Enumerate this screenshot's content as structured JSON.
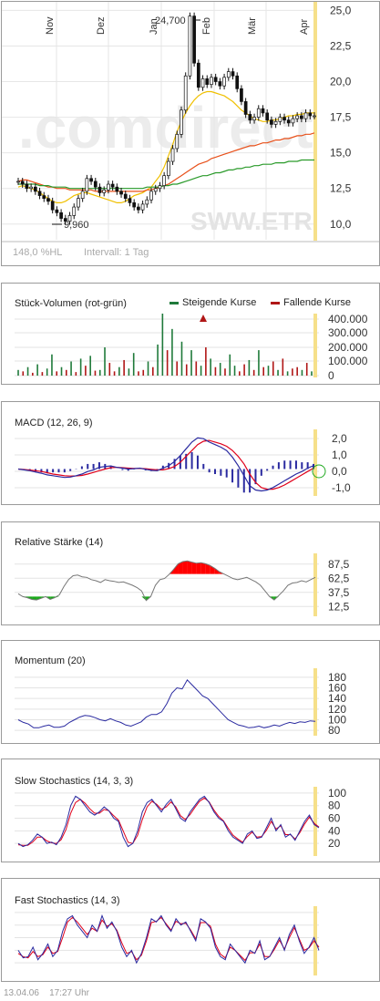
{
  "price": {
    "months": [
      "Nov",
      "Dez",
      "Jan",
      "Feb",
      "Mär",
      "Apr"
    ],
    "y_ticks": [
      "25,0",
      "22,5",
      "20,0",
      "17,5",
      "15,0",
      "12,5",
      "10,0"
    ],
    "high_label": "24,700",
    "low_label": "9,960",
    "watermark": ".comdirect",
    "ticker": "SWW.ETR",
    "info_range": "148,0 %HL",
    "info_interval": "Intervall: 1 Tag"
  },
  "volume": {
    "title": "Stück-Volumen (rot-grün)",
    "legend_up": "Steigende Kurse",
    "legend_down": "Fallende Kurse",
    "y_ticks": [
      "400.000",
      "300.000",
      "200.000",
      "100.000",
      "0"
    ]
  },
  "macd": {
    "title": "MACD (12, 26, 9)",
    "y_ticks": [
      "2,0",
      "1,0",
      "0,0",
      "-1,0"
    ]
  },
  "rsi": {
    "title": "Relative Stärke (14)",
    "y_ticks": [
      "87,5",
      "62,5",
      "37,5",
      "12,5"
    ]
  },
  "momentum": {
    "title": "Momentum (20)",
    "y_ticks": [
      "180",
      "160",
      "140",
      "120",
      "100",
      "80"
    ]
  },
  "slow_stoch": {
    "title": "Slow Stochastics (14, 3, 3)",
    "y_ticks": [
      "100",
      "80",
      "60",
      "40",
      "20"
    ]
  },
  "fast_stoch": {
    "title": "Fast Stochastics (14, 3)"
  },
  "footer": {
    "date": "13.04.06",
    "time": "17:27 Uhr"
  },
  "colors": {
    "up": "#1f7a3a",
    "down": "#b01616",
    "ma_short": "#f0c000",
    "ma_mid": "#e8501a",
    "ma_long": "#2a9a2a",
    "indicator": "#2a2aa0",
    "signal": "#e0001a",
    "highlight": "#f6e08a"
  },
  "chart_data": [
    {
      "type": "line",
      "title": "",
      "x": [
        0,
        5,
        10,
        15,
        20,
        25,
        30,
        35,
        40,
        45,
        50,
        55,
        60,
        65,
        70,
        75,
        78,
        80,
        85,
        90,
        95,
        100,
        105,
        110,
        115,
        120,
        125,
        130,
        135,
        140,
        145,
        150,
        155,
        160,
        165,
        170,
        175,
        180,
        185,
        190,
        195,
        200,
        205,
        210,
        215,
        220,
        225,
        230,
        235,
        240,
        245,
        250,
        255,
        260,
        265,
        270,
        275,
        280,
        285,
        290,
        295,
        300,
        305,
        310,
        315,
        320,
        325,
        330,
        335,
        340
      ],
      "xlabel": "",
      "ylabel": "",
      "x_axis_labels": [
        "Nov",
        "Dez",
        "Jan",
        "Feb",
        "Mär",
        "Apr"
      ],
      "ylim": [
        8.9,
        25.6
      ],
      "series": [
        {
          "values": [
            13.0,
            12.8,
            12.5,
            12.6,
            12.3,
            12.0,
            11.8,
            11.6,
            11.0,
            10.8,
            10.4,
            10.2,
            10.6,
            11.2,
            11.8,
            12.3,
            13.2,
            13.0,
            12.6,
            12.2,
            12.4,
            12.8,
            12.6,
            12.3,
            12.1,
            11.8,
            11.5,
            11.2,
            11.0,
            11.4,
            11.7,
            12.3,
            12.5,
            12.7,
            13.4,
            14.4,
            15.3,
            16.3,
            18.0,
            20.4,
            24.6,
            21.3,
            19.6,
            20.2,
            19.8,
            20.3,
            20.0,
            19.7,
            20.3,
            20.7,
            20.4,
            19.5,
            18.6,
            17.7,
            17.3,
            17.5,
            18.1,
            17.8,
            17.3,
            17.0,
            17.2,
            17.5,
            17.3,
            17.1,
            17.4,
            17.6,
            17.4,
            17.8,
            17.6,
            17.6
          ]
        },
        {
          "values": [
            12.6,
            12.7,
            12.6,
            12.5,
            12.4,
            12.2,
            12.0,
            11.8,
            11.6,
            11.5,
            11.5,
            11.6,
            11.8,
            12.0,
            12.1,
            12.2,
            12.2,
            12.1,
            12.0,
            11.9,
            11.8,
            11.7,
            11.6,
            11.5,
            11.5,
            11.6,
            11.8,
            12.0,
            12.1,
            12.2,
            12.4,
            12.6,
            13.0,
            13.4,
            14.0,
            14.8,
            15.6,
            16.5,
            17.2,
            17.8,
            18.3,
            18.7,
            19.0,
            19.2,
            19.3,
            19.3,
            19.2,
            19.1,
            19.0,
            18.8,
            18.6,
            18.3,
            18.0,
            17.8,
            17.6,
            17.4,
            17.3,
            17.2,
            17.2,
            17.3,
            17.3,
            17.4,
            17.5,
            17.6,
            17.6,
            17.7,
            17.7,
            17.8,
            17.8,
            17.8
          ]
        },
        {
          "values": [
            13.0,
            13.1,
            13.1,
            13.0,
            12.9,
            12.8,
            12.7,
            12.6,
            12.6,
            12.5,
            12.5,
            12.5,
            12.4,
            12.4,
            12.4,
            12.4,
            12.4,
            12.4,
            12.3,
            12.3,
            12.3,
            12.3,
            12.3,
            12.3,
            12.3,
            12.3,
            12.3,
            12.3,
            12.3,
            12.3,
            12.4,
            12.4,
            12.5,
            12.6,
            12.7,
            12.8,
            13.0,
            13.2,
            13.4,
            13.6,
            13.8,
            14.0,
            14.2,
            14.3,
            14.4,
            14.6,
            14.7,
            14.8,
            14.9,
            15.0,
            15.1,
            15.2,
            15.3,
            15.4,
            15.5,
            15.5,
            15.6,
            15.7,
            15.7,
            15.8,
            15.9,
            15.9,
            16.0,
            16.0,
            16.1,
            16.2,
            16.2,
            16.3,
            16.3,
            16.4
          ]
        },
        {
          "values": [
            12.8,
            12.8,
            12.8,
            12.8,
            12.8,
            12.7,
            12.7,
            12.7,
            12.6,
            12.6,
            12.6,
            12.6,
            12.5,
            12.5,
            12.5,
            12.5,
            12.5,
            12.5,
            12.5,
            12.5,
            12.5,
            12.5,
            12.5,
            12.5,
            12.5,
            12.5,
            12.5,
            12.5,
            12.5,
            12.5,
            12.6,
            12.6,
            12.6,
            12.6,
            12.7,
            12.7,
            12.8,
            12.8,
            12.9,
            13.0,
            13.1,
            13.2,
            13.3,
            13.4,
            13.4,
            13.5,
            13.6,
            13.6,
            13.7,
            13.8,
            13.8,
            13.9,
            13.9,
            14.0,
            14.0,
            14.1,
            14.1,
            14.2,
            14.2,
            14.2,
            14.3,
            14.3,
            14.3,
            14.4,
            14.4,
            14.4,
            14.5,
            14.5,
            14.5,
            14.5
          ]
        }
      ]
    },
    {
      "type": "bar",
      "title": "",
      "ylim": [
        0,
        400000
      ],
      "values": [
        40000,
        30000,
        60000,
        20000,
        80000,
        25000,
        50000,
        150000,
        30000,
        60000,
        40000,
        100000,
        25000,
        120000,
        70000,
        140000,
        35000,
        40000,
        200000,
        90000,
        30000,
        60000,
        110000,
        50000,
        160000,
        30000,
        40000,
        100000,
        60000,
        220000,
        450000,
        180000,
        330000,
        100000,
        240000,
        80000,
        180000,
        100000,
        70000,
        200000,
        120000,
        60000,
        90000,
        50000,
        150000,
        70000,
        30000,
        80000,
        110000,
        40000,
        180000,
        60000,
        70000,
        100000,
        40000,
        120000,
        30000,
        50000,
        60000,
        40000,
        90000,
        30000
      ],
      "directions": [
        "u",
        "d",
        "u",
        "d",
        "u",
        "d",
        "u",
        "u",
        "d",
        "u",
        "d",
        "u",
        "d",
        "u",
        "d",
        "u",
        "d",
        "u",
        "u",
        "d",
        "d",
        "u",
        "d",
        "u",
        "u",
        "d",
        "d",
        "u",
        "d",
        "u",
        "u",
        "d",
        "u",
        "d",
        "u",
        "d",
        "u",
        "d",
        "u",
        "d",
        "u",
        "d",
        "u",
        "d",
        "u",
        "u",
        "d",
        "d",
        "u",
        "d",
        "u",
        "d",
        "u",
        "d",
        "u",
        "d",
        "u",
        "d",
        "d",
        "u",
        "d",
        "u"
      ]
    },
    {
      "type": "line",
      "title": "",
      "ylim": [
        -1.6,
        2.3
      ],
      "series": [
        {
          "values": [
            0,
            -0.05,
            -0.1,
            -0.18,
            -0.25,
            -0.35,
            -0.4,
            -0.45,
            -0.5,
            -0.48,
            -0.4,
            -0.3,
            -0.15,
            -0.05,
            0.1,
            0.15,
            0.18,
            0.1,
            0.05,
            0,
            0.02,
            0.05,
            -0.02,
            -0.08,
            -0.1,
            0.05,
            0.2,
            0.45,
            0.8,
            1.2,
            1.6,
            1.85,
            1.8,
            1.6,
            1.45,
            1.3,
            1.1,
            0.7,
            0.2,
            -0.4,
            -1.0,
            -1.25,
            -1.3,
            -1.25,
            -1.1,
            -0.9,
            -0.7,
            -0.5,
            -0.3,
            -0.15,
            0.05,
            0.2
          ]
        },
        {
          "values": [
            0,
            -0.03,
            -0.06,
            -0.1,
            -0.15,
            -0.22,
            -0.3,
            -0.35,
            -0.4,
            -0.42,
            -0.41,
            -0.38,
            -0.3,
            -0.2,
            -0.1,
            0,
            0.08,
            0.1,
            0.08,
            0.05,
            0.03,
            0.03,
            0.02,
            -0.02,
            -0.05,
            -0.05,
            0.02,
            0.15,
            0.4,
            0.75,
            1.1,
            1.45,
            1.65,
            1.7,
            1.6,
            1.5,
            1.35,
            1.1,
            0.75,
            0.3,
            -0.3,
            -0.8,
            -1.1,
            -1.2,
            -1.2,
            -1.1,
            -0.95,
            -0.75,
            -0.55,
            -0.35,
            -0.15,
            0.05
          ]
        }
      ]
    },
    {
      "type": "line",
      "title": "",
      "ylim": [
        0,
        100
      ],
      "values": [
        35,
        30,
        28,
        25,
        24,
        27,
        30,
        25,
        28,
        33,
        48,
        60,
        67,
        68,
        65,
        64,
        60,
        58,
        55,
        60,
        58,
        57,
        55,
        56,
        53,
        50,
        46,
        40,
        23,
        30,
        50,
        60,
        62,
        69,
        78,
        88,
        92,
        93,
        91,
        89,
        90,
        88,
        85,
        80,
        74,
        70,
        66,
        62,
        60,
        62,
        64,
        60,
        56,
        50,
        40,
        30,
        24,
        32,
        40,
        50,
        54,
        55,
        58,
        56,
        60,
        64
      ]
    },
    {
      "type": "line",
      "title": "",
      "ylim": [
        70,
        190
      ],
      "values": [
        100,
        95,
        92,
        85,
        85,
        88,
        90,
        86,
        86,
        88,
        95,
        100,
        105,
        108,
        107,
        104,
        100,
        98,
        102,
        98,
        95,
        90,
        88,
        92,
        96,
        105,
        110,
        110,
        115,
        130,
        150,
        160,
        158,
        175,
        165,
        155,
        145,
        140,
        130,
        120,
        110,
        100,
        95,
        90,
        88,
        85,
        86,
        88,
        85,
        87,
        90,
        88,
        92,
        95,
        93,
        96,
        95,
        98,
        97
      ]
    },
    {
      "type": "line",
      "title": "",
      "ylim": [
        0,
        110
      ],
      "series": [
        {
          "values": [
            20,
            15,
            18,
            25,
            35,
            30,
            20,
            22,
            18,
            30,
            50,
            80,
            95,
            90,
            80,
            70,
            65,
            70,
            78,
            72,
            60,
            55,
            30,
            15,
            20,
            40,
            70,
            85,
            90,
            80,
            70,
            82,
            90,
            75,
            60,
            55,
            70,
            80,
            90,
            95,
            85,
            70,
            60,
            55,
            40,
            30,
            25,
            20,
            35,
            40,
            28,
            30,
            45,
            60,
            40,
            50,
            30,
            35,
            25,
            40,
            55,
            65,
            50,
            45
          ]
        },
        {
          "values": [
            18,
            17,
            17,
            22,
            30,
            30,
            24,
            21,
            20,
            26,
            42,
            68,
            85,
            90,
            84,
            75,
            68,
            68,
            74,
            72,
            64,
            57,
            40,
            22,
            20,
            33,
            58,
            78,
            87,
            82,
            74,
            78,
            86,
            78,
            64,
            58,
            66,
            77,
            87,
            92,
            86,
            73,
            63,
            56,
            44,
            33,
            27,
            22,
            31,
            38,
            30,
            31,
            41,
            55,
            43,
            48,
            34,
            34,
            27,
            37,
            51,
            62,
            52,
            46
          ]
        }
      ]
    },
    {
      "type": "line",
      "title": "",
      "ylim": [
        0,
        110
      ],
      "series": [
        {
          "values": [
            40,
            28,
            30,
            45,
            25,
            35,
            50,
            30,
            40,
            70,
            90,
            95,
            80,
            70,
            60,
            80,
            70,
            95,
            75,
            85,
            70,
            45,
            30,
            40,
            20,
            35,
            60,
            90,
            85,
            95,
            80,
            70,
            90,
            80,
            85,
            70,
            55,
            90,
            85,
            75,
            45,
            30,
            25,
            50,
            40,
            30,
            20,
            40,
            35,
            55,
            25,
            30,
            45,
            60,
            40,
            65,
            80,
            55,
            35,
            45,
            60,
            40
          ]
        },
        {
          "values": [
            35,
            30,
            28,
            38,
            30,
            33,
            45,
            35,
            38,
            60,
            85,
            92,
            85,
            75,
            65,
            75,
            70,
            88,
            78,
            82,
            72,
            52,
            35,
            38,
            25,
            32,
            55,
            84,
            86,
            92,
            82,
            72,
            86,
            82,
            83,
            72,
            58,
            84,
            84,
            78,
            50,
            34,
            28,
            45,
            40,
            32,
            24,
            36,
            36,
            50,
            30,
            30,
            42,
            56,
            42,
            60,
            76,
            58,
            40,
            44,
            55,
            45
          ]
        }
      ]
    }
  ]
}
